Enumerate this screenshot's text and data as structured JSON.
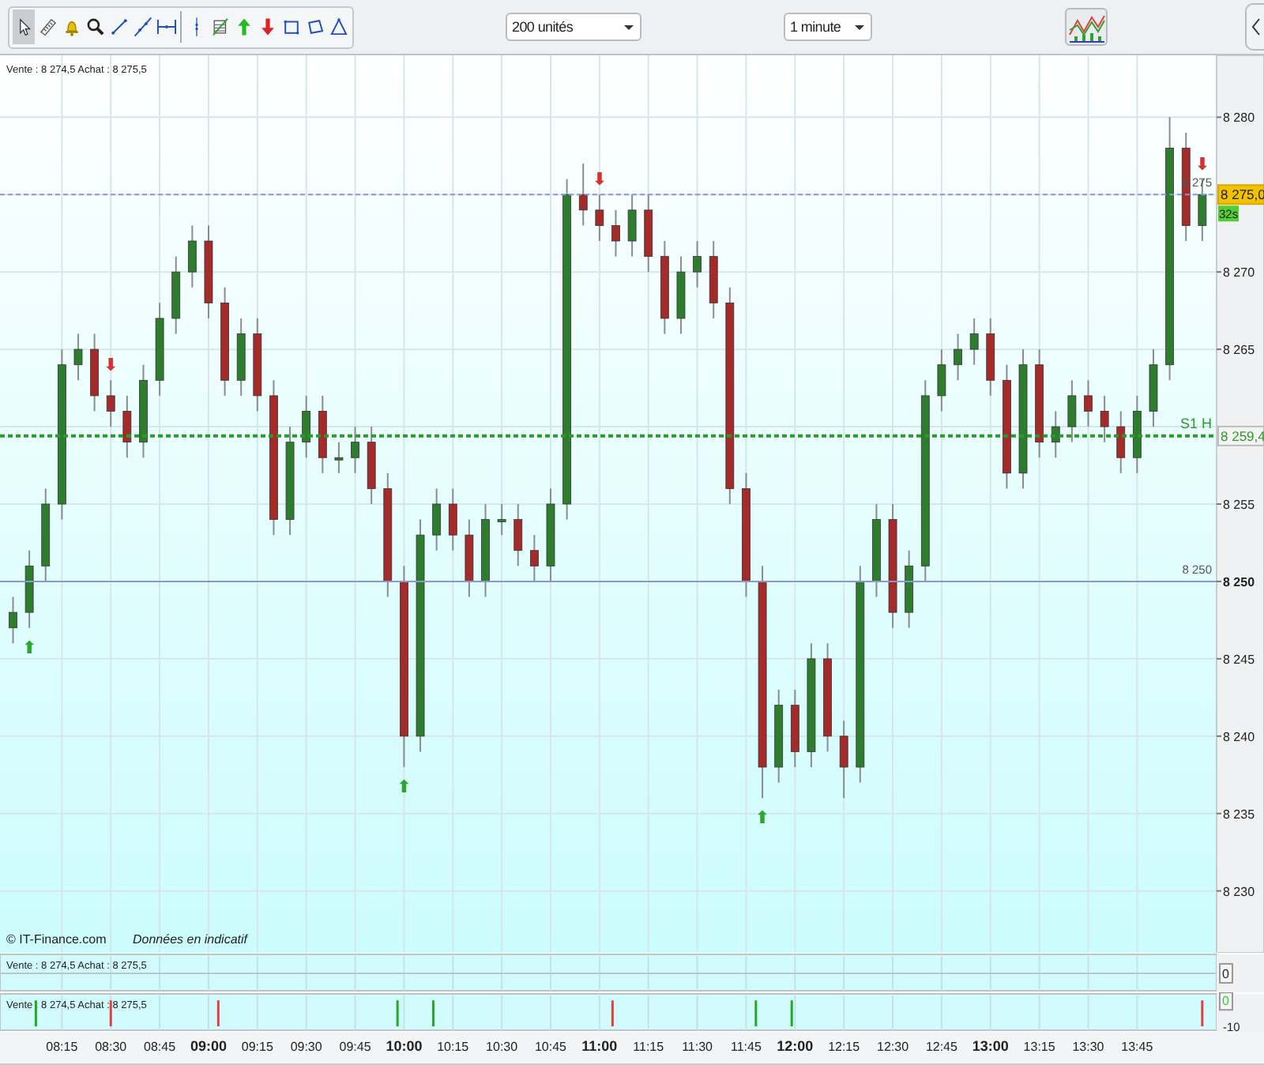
{
  "toolbar": {
    "tools": [
      {
        "kind": "pointer",
        "selected": true
      },
      {
        "kind": "ruler",
        "selected": false
      },
      {
        "kind": "alert",
        "selected": false
      },
      {
        "kind": "zoom",
        "selected": false
      },
      {
        "kind": "segment",
        "selected": false
      },
      {
        "kind": "line",
        "selected": false
      },
      {
        "kind": "hline",
        "selected": false
      },
      {
        "kind": "vline",
        "selected": false
      },
      {
        "kind": "fib",
        "selected": false
      },
      {
        "kind": "buy",
        "selected": false
      },
      {
        "kind": "sell",
        "selected": false
      },
      {
        "kind": "rectangle",
        "selected": false
      },
      {
        "kind": "channel",
        "selected": false
      },
      {
        "kind": "triangle",
        "selected": false
      }
    ],
    "dropdowns": [
      {
        "value": "200 unités"
      },
      {
        "value": "1 minute"
      }
    ]
  },
  "chart": {
    "quote": "Vente : 8 274,5 Achat : 8 275,5",
    "copyright": "© IT-Finance.com",
    "disclaimer": "Données en indicatif",
    "price_tags": [
      {
        "kind": "last",
        "text": "8 275,0"
      },
      {
        "kind": "countdown",
        "text": "32s"
      },
      {
        "kind": "pivot",
        "text": "8 259,4"
      }
    ],
    "chart_data": {
      "type": "candlestick",
      "grid": true,
      "xlim": [
        476,
        849.4
      ],
      "ylim": [
        8226,
        8284
      ],
      "x": [
        480,
        485,
        490,
        495,
        500,
        505,
        510,
        515,
        520,
        525,
        530,
        535,
        540,
        545,
        550,
        555,
        560,
        565,
        570,
        575,
        580,
        585,
        590,
        595,
        600,
        605,
        610,
        615,
        620,
        625,
        630,
        635,
        640,
        645,
        650,
        655,
        660,
        665,
        670,
        675,
        680,
        685,
        690,
        695,
        700,
        705,
        710,
        715,
        720,
        725,
        730,
        735,
        740,
        745,
        750,
        755,
        760,
        765,
        770,
        775,
        780,
        785,
        790,
        795,
        800,
        805,
        810,
        815,
        820,
        825,
        830,
        835,
        840,
        845
      ],
      "ohlc": [
        [
          8247,
          8249,
          8246,
          8248
        ],
        [
          8248,
          8252,
          8247,
          8251
        ],
        [
          8251,
          8256,
          8250,
          8255
        ],
        [
          8255,
          8265,
          8254,
          8264
        ],
        [
          8264,
          8266,
          8263,
          8265
        ],
        [
          8265,
          8266,
          8261,
          8262
        ],
        [
          8262,
          8263,
          8260,
          8261
        ],
        [
          8261,
          8262,
          8258,
          8259
        ],
        [
          8259,
          8264,
          8258,
          8263
        ],
        [
          8263,
          8268,
          8262,
          8267
        ],
        [
          8267,
          8271,
          8266,
          8270
        ],
        [
          8270,
          8273,
          8269,
          8272
        ],
        [
          8272,
          8273,
          8267,
          8268
        ],
        [
          8268,
          8269,
          8262,
          8263
        ],
        [
          8263,
          8267,
          8262,
          8266
        ],
        [
          8266,
          8267,
          8261,
          8262
        ],
        [
          8262,
          8263,
          8253,
          8254
        ],
        [
          8254,
          8260,
          8253,
          8259
        ],
        [
          8259,
          8262,
          8258,
          8261
        ],
        [
          8261,
          8262,
          8257,
          8258
        ],
        [
          8258,
          8259,
          8257,
          8258
        ],
        [
          8258,
          8260,
          8257,
          8259
        ],
        [
          8259,
          8260,
          8255,
          8256
        ],
        [
          8256,
          8257,
          8249,
          8250
        ],
        [
          8250,
          8251,
          8238,
          8240
        ],
        [
          8240,
          8254,
          8239,
          8253
        ],
        [
          8253,
          8256,
          8252,
          8255
        ],
        [
          8255,
          8256,
          8252,
          8253
        ],
        [
          8253,
          8254,
          8249,
          8250
        ],
        [
          8250,
          8255,
          8249,
          8254
        ],
        [
          8254,
          8255,
          8253,
          8254
        ],
        [
          8254,
          8255,
          8251,
          8252
        ],
        [
          8252,
          8253,
          8250,
          8251
        ],
        [
          8251,
          8256,
          8250,
          8255
        ],
        [
          8255,
          8276,
          8254,
          8275
        ],
        [
          8275,
          8277,
          8273,
          8274
        ],
        [
          8274,
          8275,
          8272,
          8273
        ],
        [
          8273,
          8274,
          8271,
          8272
        ],
        [
          8272,
          8275,
          8271,
          8274
        ],
        [
          8274,
          8275,
          8270,
          8271
        ],
        [
          8271,
          8272,
          8266,
          8267
        ],
        [
          8267,
          8271,
          8266,
          8270
        ],
        [
          8270,
          8272,
          8269,
          8271
        ],
        [
          8271,
          8272,
          8267,
          8268
        ],
        [
          8268,
          8269,
          8255,
          8256
        ],
        [
          8256,
          8257,
          8249,
          8250
        ],
        [
          8250,
          8251,
          8236,
          8238
        ],
        [
          8238,
          8243,
          8237,
          8242
        ],
        [
          8242,
          8243,
          8238,
          8239
        ],
        [
          8239,
          8246,
          8238,
          8245
        ],
        [
          8245,
          8246,
          8239,
          8240
        ],
        [
          8240,
          8241,
          8236,
          8238
        ],
        [
          8238,
          8251,
          8237,
          8250
        ],
        [
          8250,
          8255,
          8249,
          8254
        ],
        [
          8254,
          8255,
          8247,
          8248
        ],
        [
          8248,
          8252,
          8247,
          8251
        ],
        [
          8251,
          8263,
          8250,
          8262
        ],
        [
          8262,
          8265,
          8261,
          8264
        ],
        [
          8264,
          8266,
          8263,
          8265
        ],
        [
          8265,
          8267,
          8264,
          8266
        ],
        [
          8266,
          8267,
          8262,
          8263
        ],
        [
          8263,
          8264,
          8256,
          8257
        ],
        [
          8257,
          8265,
          8256,
          8264
        ],
        [
          8264,
          8265,
          8258,
          8259
        ],
        [
          8259,
          8261,
          8258,
          8260
        ],
        [
          8260,
          8263,
          8259,
          8262
        ],
        [
          8262,
          8263,
          8260,
          8261
        ],
        [
          8261,
          8262,
          8259,
          8260
        ],
        [
          8260,
          8261,
          8257,
          8258
        ],
        [
          8258,
          8262,
          8257,
          8261
        ],
        [
          8261,
          8265,
          8260,
          8264
        ],
        [
          8264,
          8280,
          8263,
          8278
        ],
        [
          8278,
          8279,
          8272,
          8273
        ],
        [
          8273,
          8276,
          8272,
          8275
        ]
      ],
      "xticks": [
        {
          "value": 495,
          "label": "08:15"
        },
        {
          "value": 510,
          "label": "08:30"
        },
        {
          "value": 525,
          "label": "08:45"
        },
        {
          "value": 540,
          "label": "09:00"
        },
        {
          "value": 555,
          "label": "09:15"
        },
        {
          "value": 570,
          "label": "09:30"
        },
        {
          "value": 585,
          "label": "09:45"
        },
        {
          "value": 600,
          "label": "10:00"
        },
        {
          "value": 615,
          "label": "10:15"
        },
        {
          "value": 630,
          "label": "10:30"
        },
        {
          "value": 645,
          "label": "10:45"
        },
        {
          "value": 660,
          "label": "11:00"
        },
        {
          "value": 675,
          "label": "11:15"
        },
        {
          "value": 690,
          "label": "11:30"
        },
        {
          "value": 705,
          "label": "11:45"
        },
        {
          "value": 720,
          "label": "12:00"
        },
        {
          "value": 735,
          "label": "12:15"
        },
        {
          "value": 750,
          "label": "12:30"
        },
        {
          "value": 765,
          "label": "12:45"
        },
        {
          "value": 780,
          "label": "13:00"
        },
        {
          "value": 795,
          "label": "13:15"
        },
        {
          "value": 810,
          "label": "13:30"
        },
        {
          "value": 825,
          "label": "13:45"
        }
      ],
      "yticks": [
        {
          "value": 8230,
          "label": "8 230"
        },
        {
          "value": 8235,
          "label": "8 235"
        },
        {
          "value": 8240,
          "label": "8 240"
        },
        {
          "value": 8245,
          "label": "8 245"
        },
        {
          "value": 8250,
          "label": "8 250"
        },
        {
          "value": 8255,
          "label": "8 255"
        },
        {
          "value": 8265,
          "label": "8 265"
        },
        {
          "value": 8270,
          "label": "8 270"
        },
        {
          "value": 8280,
          "label": "8 280"
        }
      ],
      "ref_lines": [
        {
          "axis": "y",
          "value": 8275,
          "label": "8 275",
          "color": "#8a9ad8"
        },
        {
          "axis": "y",
          "value": 8259.4,
          "label": "S1 H",
          "color": "#2a9a2a"
        },
        {
          "axis": "y",
          "value": 8250,
          "label": "8 250",
          "color": "#8b96d8"
        }
      ],
      "annotations": [
        {
          "x": 485,
          "y": 8247,
          "text": "⬆"
        },
        {
          "x": 510,
          "y": 8263,
          "text": "⬇"
        },
        {
          "x": 600,
          "y": 8238,
          "text": "⬆"
        },
        {
          "x": 660,
          "y": 8275,
          "text": "⬇"
        },
        {
          "x": 710,
          "y": 8236,
          "text": "⬆"
        },
        {
          "x": 845,
          "y": 8276,
          "text": "⬇"
        }
      ]
    }
  },
  "panels": [
    {
      "quote": "Vente : 8 274,5 Achat : 8 275,5",
      "scale": "0"
    },
    {
      "quote": "Vente : 8 274,5 Achat : 8 275,5",
      "chart_data": {
        "type": "bar",
        "grid": true,
        "xlim": [
          476,
          849.4
        ],
        "ylim": [
          -11.5,
          2.5
        ],
        "x": [
          487,
          510,
          543,
          598,
          609,
          664,
          708,
          719,
          845
        ],
        "series": [
          {
            "color": "#22aa22",
            "values": [
              -10,
              null,
              null,
              -10,
              -10,
              null,
              -10,
              -10,
              null
            ]
          },
          {
            "color": "#e04040",
            "values": [
              null,
              -10,
              -10,
              null,
              null,
              -10,
              null,
              null,
              -10
            ]
          }
        ],
        "yticks": [
          {
            "value": 0,
            "label": "0"
          },
          {
            "value": -10,
            "label": "-10"
          }
        ]
      }
    }
  ]
}
